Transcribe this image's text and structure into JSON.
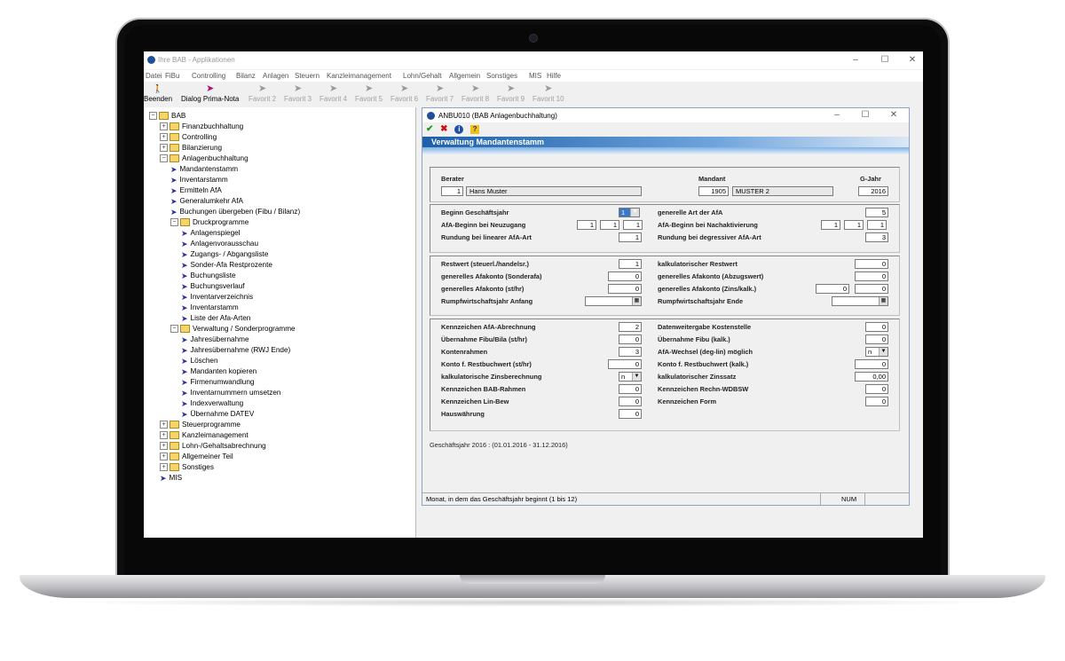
{
  "app": {
    "title": "Ihre BAB - Applikationen",
    "win_min": "–",
    "win_max": "☐",
    "win_close": "✕"
  },
  "menu": [
    "Datei",
    "FiBu",
    "Controlling",
    "Bilanz",
    "Anlagen",
    "Steuern",
    "Kanzleimanagement",
    "Lohn/Gehalt",
    "Allgemein",
    "Sonstiges",
    "MIS",
    "Hilfe"
  ],
  "toolbar": [
    {
      "label": "Beenden",
      "icon": "exit-icon",
      "state": "active"
    },
    {
      "label": "Dialog Prima-Nota",
      "icon": "arrow-icon",
      "state": "active"
    },
    {
      "label": "Favorit 2",
      "icon": "arrow-icon",
      "state": "disabled"
    },
    {
      "label": "Favorit 3",
      "icon": "arrow-icon",
      "state": "disabled"
    },
    {
      "label": "Favorit 4",
      "icon": "arrow-icon",
      "state": "disabled"
    },
    {
      "label": "Favorit 5",
      "icon": "arrow-icon",
      "state": "disabled"
    },
    {
      "label": "Favorit 6",
      "icon": "arrow-icon",
      "state": "disabled"
    },
    {
      "label": "Favorit 7",
      "icon": "arrow-icon",
      "state": "disabled"
    },
    {
      "label": "Favorit 8",
      "icon": "arrow-icon",
      "state": "disabled"
    },
    {
      "label": "Favorit 9",
      "icon": "arrow-icon",
      "state": "disabled"
    },
    {
      "label": "Favorit 10",
      "icon": "arrow-icon",
      "state": "disabled"
    }
  ],
  "tree": [
    {
      "label": "BAB",
      "kind": "folder-open",
      "pm": "−",
      "level": 0
    },
    {
      "label": "Finanzbuchhaltung",
      "kind": "folder",
      "pm": "+",
      "level": 1
    },
    {
      "label": "Controlling",
      "kind": "folder",
      "pm": "+",
      "level": 1
    },
    {
      "label": "Bilanzierung",
      "kind": "folder",
      "pm": "+",
      "level": 1
    },
    {
      "label": "Anlagenbuchhaltung",
      "kind": "folder-open",
      "pm": "−",
      "level": 1
    },
    {
      "label": "Mandantenstamm",
      "kind": "item",
      "level": 2
    },
    {
      "label": "Inventarstamm",
      "kind": "item",
      "level": 2
    },
    {
      "label": "Ermitteln AfA",
      "kind": "item",
      "level": 2
    },
    {
      "label": "Generalumkehr AfA",
      "kind": "item",
      "level": 2
    },
    {
      "label": "Buchungen übergeben (Fibu / Bilanz)",
      "kind": "item",
      "level": 2
    },
    {
      "label": "Druckprogramme",
      "kind": "folder-open",
      "pm": "−",
      "level": 2
    },
    {
      "label": "Anlagenspiegel",
      "kind": "item",
      "level": 3
    },
    {
      "label": "Anlagenvorausschau",
      "kind": "item",
      "level": 3
    },
    {
      "label": "Zugangs- / Abgangsliste",
      "kind": "item",
      "level": 3
    },
    {
      "label": "Sonder-Afa Restprozente",
      "kind": "item",
      "level": 3
    },
    {
      "label": "Buchungsliste",
      "kind": "item",
      "level": 3
    },
    {
      "label": "Buchungsverlauf",
      "kind": "item",
      "level": 3
    },
    {
      "label": "Inventarverzeichnis",
      "kind": "item",
      "level": 3
    },
    {
      "label": "Inventarstamm",
      "kind": "item",
      "level": 3
    },
    {
      "label": "Liste der Afa-Arten",
      "kind": "item",
      "level": 3
    },
    {
      "label": "Verwaltung / Sonderprogramme",
      "kind": "folder-open",
      "pm": "−",
      "level": 2
    },
    {
      "label": "Jahresübernahme",
      "kind": "item",
      "level": 3
    },
    {
      "label": "Jahresübernahme (RWJ Ende)",
      "kind": "item",
      "level": 3
    },
    {
      "label": "Löschen",
      "kind": "item",
      "level": 3
    },
    {
      "label": "Mandanten kopieren",
      "kind": "item",
      "level": 3
    },
    {
      "label": "Firmenumwandlung",
      "kind": "item",
      "level": 3
    },
    {
      "label": "Inventarnummern umsetzen",
      "kind": "item",
      "level": 3
    },
    {
      "label": "Indexverwaltung",
      "kind": "item",
      "level": 3
    },
    {
      "label": "Übernahme DATEV",
      "kind": "item",
      "level": 3
    },
    {
      "label": "Steuerprogramme",
      "kind": "folder",
      "pm": "+",
      "level": 1
    },
    {
      "label": "Kanzleimanagement",
      "kind": "folder",
      "pm": "+",
      "level": 1
    },
    {
      "label": "Lohn-/Gehaltsabrechnung",
      "kind": "folder",
      "pm": "+",
      "level": 1
    },
    {
      "label": "Allgemeiner Teil",
      "kind": "folder",
      "pm": "+",
      "level": 1
    },
    {
      "label": "Sonstiges",
      "kind": "folder",
      "pm": "+",
      "level": 1
    },
    {
      "label": "MIS",
      "kind": "item",
      "level": 1
    }
  ],
  "dialog": {
    "title": "ANBU010 (BAB Anlagenbuchhaltung)",
    "banner": "Verwaltung Mandantenstamm",
    "tools": {
      "ok": "✔",
      "cancel": "✖",
      "info": "i",
      "help": "?"
    },
    "header": {
      "berater_label": "Berater",
      "berater_nr": "1",
      "berater_name": "Hans Muster",
      "mandant_label": "Mandant",
      "mandant_nr": "1905",
      "mandant_name": "MUSTER 2",
      "gjahr_label": "G-Jahr",
      "gjahr": "2016"
    },
    "g1": {
      "beginn_label": "Beginn Geschäftsjahr",
      "beginn_value": "1",
      "afa_neu_label": "AfA-Beginn bei Neuzugang",
      "afa_neu": [
        "1",
        "1",
        "1"
      ],
      "rundung_lin_label": "Rundung bei linearer AfA-Art",
      "rundung_lin": "1",
      "art_afa_label": "generelle Art der AfA",
      "art_afa": "5",
      "afa_nach_label": "AfA-Beginn bei Nachaktivierung",
      "afa_nach": [
        "1",
        "1",
        "1"
      ],
      "rundung_deg_label": "Rundung bei degressiver AfA-Art",
      "rundung_deg": "3"
    },
    "g2": {
      "restwert_label": "Restwert (steuerl./handelsr.)",
      "restwert": "1",
      "afakonto_sonder_label": "generelles Afakonto (Sonderafa)",
      "afakonto_sonder": "0",
      "afakonto_sthr_label": "generelles Afakonto (st/hr)",
      "afakonto_sthr": "0",
      "rumpf_anf_label": "Rumpfwirtschaftsjahr Anfang",
      "kalk_restwert_label": "kalkulatorischer Restwert",
      "kalk_restwert": "0",
      "afakonto_abzug_label": "generelles Afakonto (Abzugswert)",
      "afakonto_abzug": "0",
      "afakonto_zins_label": "generelles Afakonto (Zins/kalk.)",
      "afakonto_zins_a": "0",
      "afakonto_zins_b": "0",
      "rumpf_ende_label": "Rumpfwirtschaftsjahr Ende"
    },
    "g3": {
      "left": [
        {
          "label": "Kennzeichen AfA-Abrechnung",
          "value": "2"
        },
        {
          "label": "Übernahme Fibu/Bila (st/hr)",
          "value": "0"
        },
        {
          "label": "Kontenrahmen",
          "value": "3"
        },
        {
          "label": "Konto f. Restbuchwert (st/hr)",
          "value": "0"
        },
        {
          "label": "kalkulatorische Zinsberechnung",
          "value": "n"
        },
        {
          "label": "Kennzeichen BAB-Rahmen",
          "value": "0"
        },
        {
          "label": "Kennzeichen Lin-Bew",
          "value": "0"
        },
        {
          "label": "Hauswährung",
          "value": "0"
        }
      ],
      "right": [
        {
          "label": "Datenweitergabe Kostenstelle",
          "value": "0"
        },
        {
          "label": "Übernahme Fibu (kalk.)",
          "value": "0"
        },
        {
          "label": "AfA-Wechsel (deg-lin) möglich",
          "value": "n"
        },
        {
          "label": "Konto f. Restbuchwert (kalk.)",
          "value": "0"
        },
        {
          "label": "kalkulatorischer Zinssatz",
          "value": "0,00"
        },
        {
          "label": "Kennzeichen Rechn-WDBSW",
          "value": "0"
        },
        {
          "label": "Kennzeichen Form",
          "value": "0"
        }
      ]
    },
    "geschaeftsjahr": "Geschäftsjahr 2016 : (01.01.2016 - 31.12.2016)",
    "status_text": "Monat, in dem das Geschäftsjahr beginnt (1 bis 12)",
    "status_num": "NUM"
  }
}
